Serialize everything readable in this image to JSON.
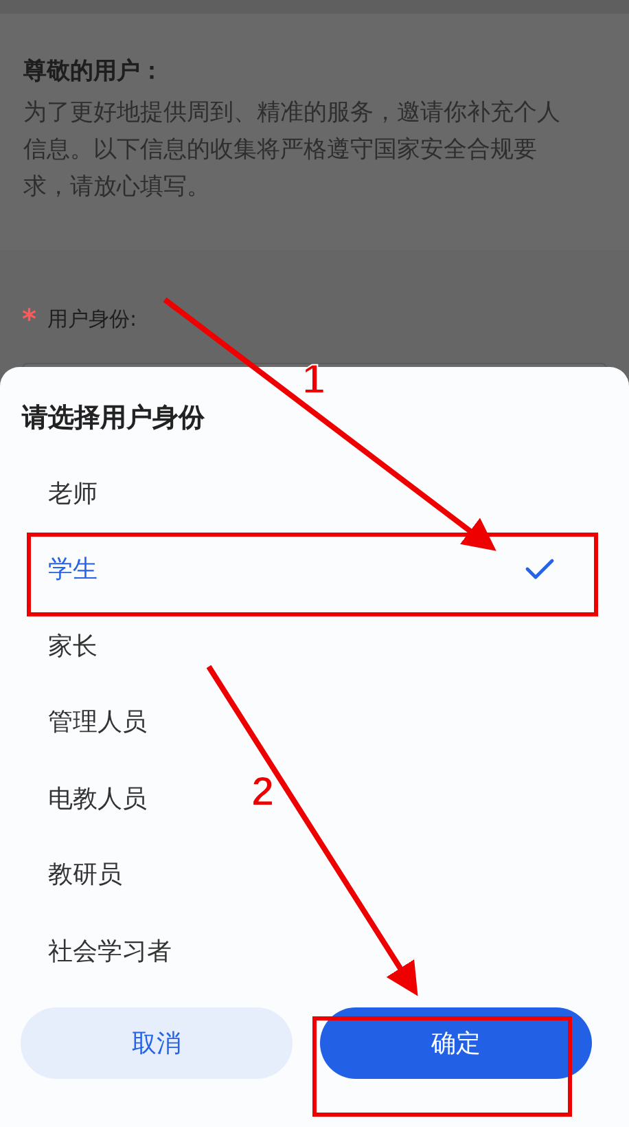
{
  "form": {
    "greeting_title": "尊敬的用户：",
    "greeting_text": "为了更好地提供周到、精准的服务，邀请你补充个人信息。以下信息的收集将严格遵守国家安全合规要求，请放心填写。",
    "required_mark": "*",
    "field_label": "用户身份:"
  },
  "sheet": {
    "title": "请选择用户身份",
    "options": [
      {
        "label": "老师",
        "selected": false
      },
      {
        "label": "学生",
        "selected": true
      },
      {
        "label": "家长",
        "selected": false
      },
      {
        "label": "管理人员",
        "selected": false
      },
      {
        "label": "电教人员",
        "selected": false
      },
      {
        "label": "教研员",
        "selected": false
      },
      {
        "label": "社会学习者",
        "selected": false
      }
    ],
    "buttons": [
      {
        "label": "取消",
        "kind": "secondary"
      },
      {
        "label": "确定",
        "kind": "primary"
      }
    ]
  },
  "annotations": [
    {
      "label": "1"
    },
    {
      "label": "2"
    }
  ]
}
